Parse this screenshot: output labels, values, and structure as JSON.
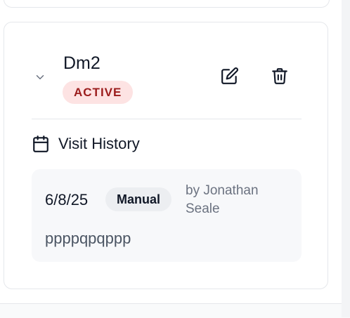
{
  "record": {
    "title": "Dm2",
    "status": "ACTIVE",
    "status_color": "#9b1c1c",
    "status_bg": "#fde3e3",
    "icons": {
      "toggle": "chevron-down-icon",
      "edit": "edit-icon",
      "delete": "trash-icon"
    }
  },
  "visit_history": {
    "heading": "Visit History",
    "icon": "calendar-icon",
    "entries": [
      {
        "date": "6/8/25",
        "type": "Manual",
        "author": "by Jonathan Seale",
        "note": "ppppqpqppp"
      }
    ]
  }
}
